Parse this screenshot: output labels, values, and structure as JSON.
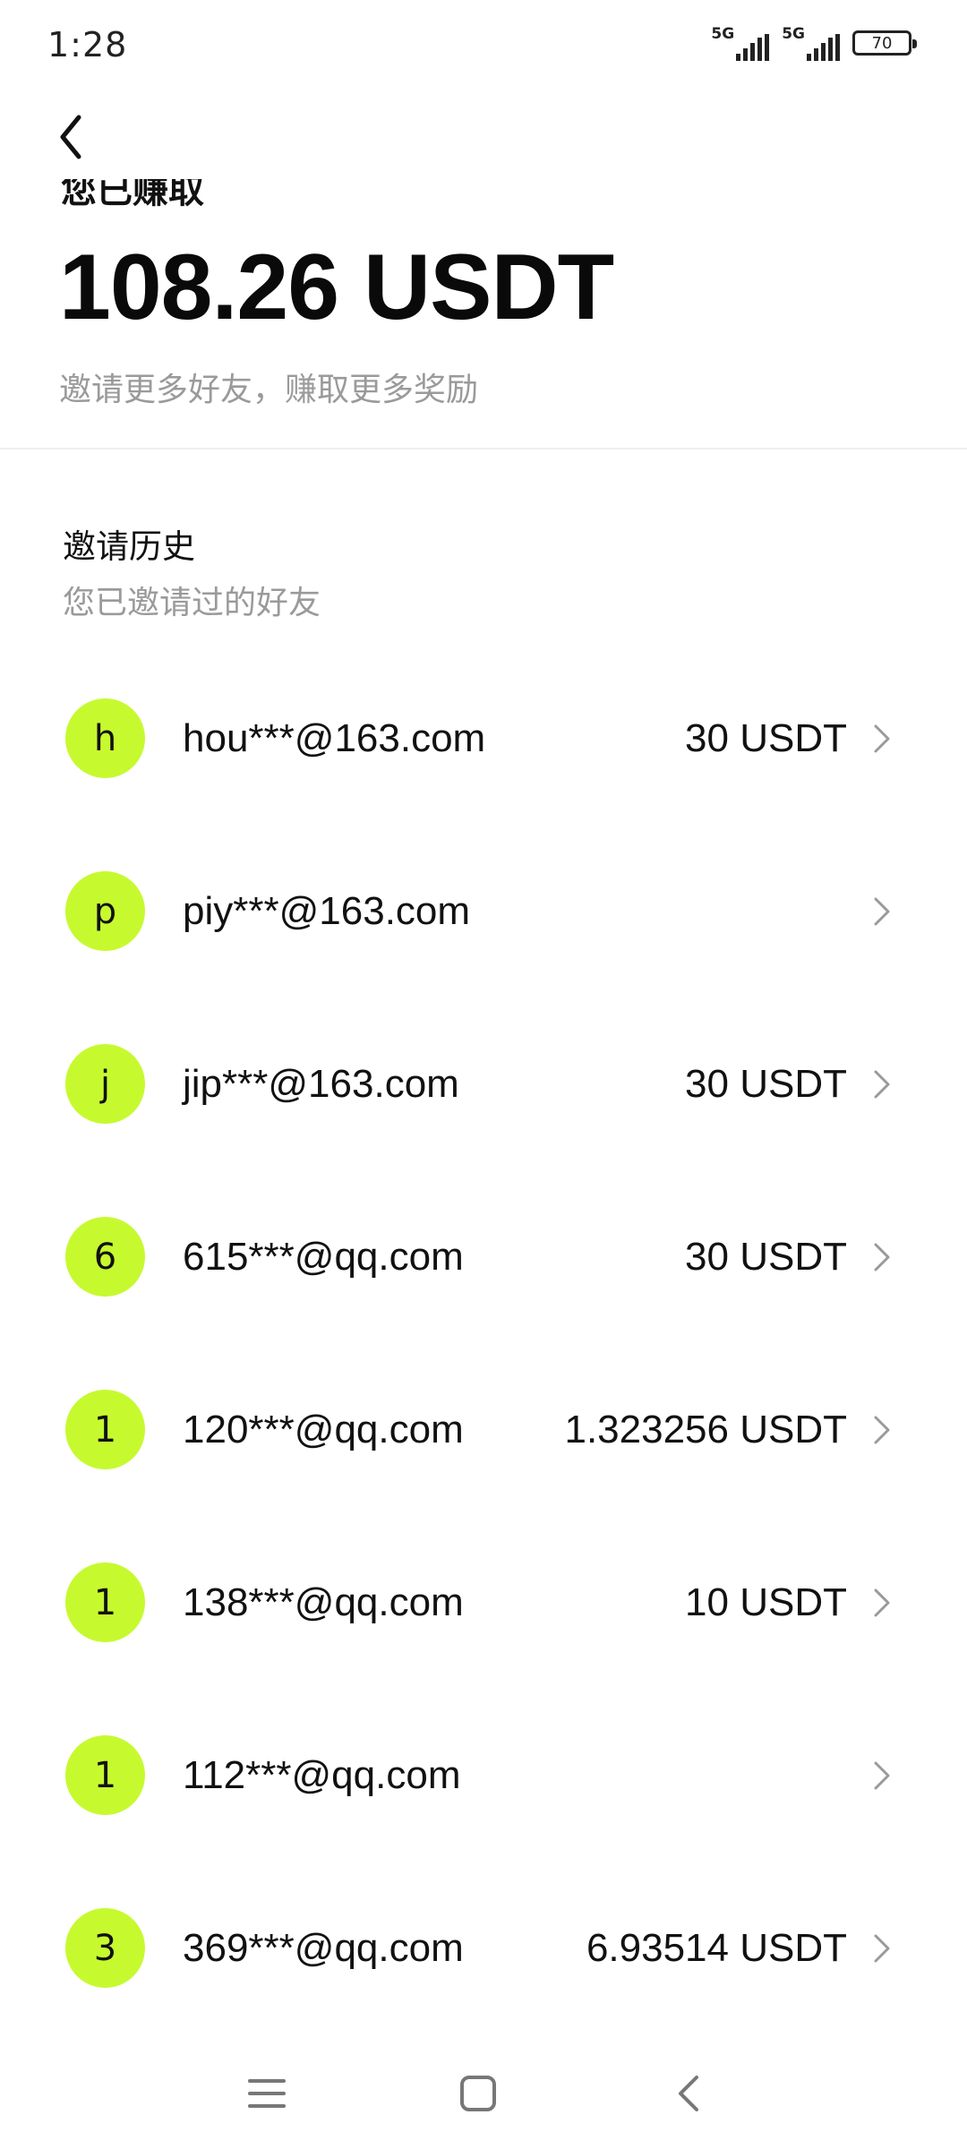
{
  "status_bar": {
    "time": "1:28",
    "network_1": "5G",
    "network_2": "5G",
    "battery": "70"
  },
  "header": {
    "back_icon": "chevron-left-icon",
    "cutoff_heading": "您已赚取",
    "earned_amount": "108.26 USDT",
    "subtitle": "邀请更多好友，赚取更多奖励"
  },
  "history": {
    "title": "邀请历史",
    "subtitle": "您已邀请过的好友",
    "items": [
      {
        "initial": "h",
        "email": "hou***@163.com",
        "reward": "30 USDT"
      },
      {
        "initial": "p",
        "email": "piy***@163.com",
        "reward": ""
      },
      {
        "initial": "j",
        "email": "jip***@163.com",
        "reward": "30 USDT"
      },
      {
        "initial": "6",
        "email": "615***@qq.com",
        "reward": "30 USDT"
      },
      {
        "initial": "1",
        "email": "120***@qq.com",
        "reward": "1.323256 USDT"
      },
      {
        "initial": "1",
        "email": "138***@qq.com",
        "reward": "10 USDT"
      },
      {
        "initial": "1",
        "email": "112***@qq.com",
        "reward": ""
      },
      {
        "initial": "3",
        "email": "369***@qq.com",
        "reward": "6.93514 USDT"
      }
    ]
  },
  "colors": {
    "avatar_bg": "#c6fa2f",
    "muted_text": "#9a9a9a"
  },
  "navbar": {
    "menu_icon": "menu-icon",
    "home_icon": "home-square-icon",
    "back_icon": "back-triangle-icon"
  }
}
